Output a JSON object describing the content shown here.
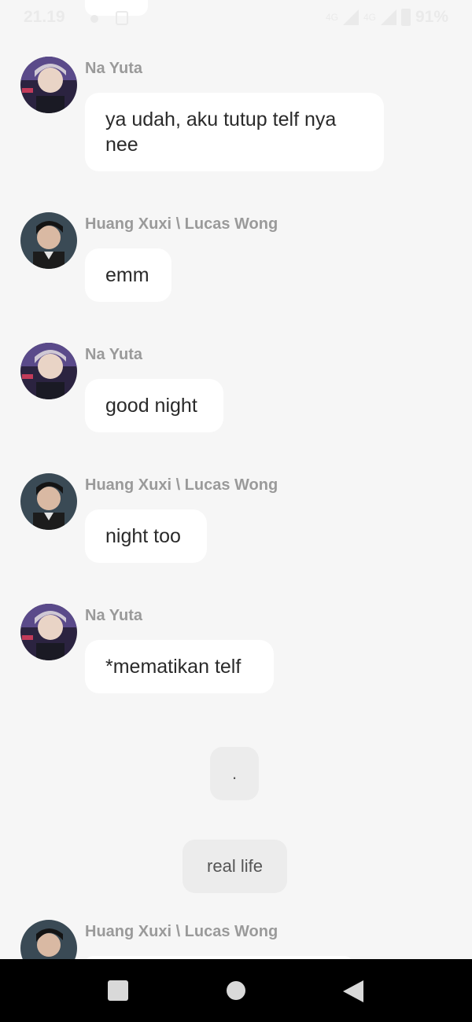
{
  "status_bar": {
    "time": "21.19",
    "network_1": "4G",
    "network_2": "4G",
    "battery": "91%"
  },
  "messages": [
    {
      "sender": "Na Yuta",
      "text": "ya udah, aku tutup telf nya nee",
      "avatar": "yuta-avatar"
    },
    {
      "sender": "Huang Xuxi \\ Lucas Wong",
      "text": "emm",
      "avatar": "lucas-avatar"
    },
    {
      "sender": "Na Yuta",
      "text": "good night",
      "avatar": "yuta-avatar"
    },
    {
      "sender": "Huang Xuxi \\ Lucas Wong",
      "text": "night too",
      "avatar": "lucas-avatar"
    },
    {
      "sender": "Na Yuta",
      "text": "*mematikan telf",
      "avatar": "yuta-avatar"
    }
  ],
  "separators": [
    ".",
    "real life"
  ],
  "last_message": {
    "sender": "Huang Xuxi \\ Lucas Wong",
    "avatar": "lucas-avatar"
  },
  "nav": {
    "recents": "square-icon",
    "home": "circle-icon",
    "back": "triangle-back-icon"
  }
}
